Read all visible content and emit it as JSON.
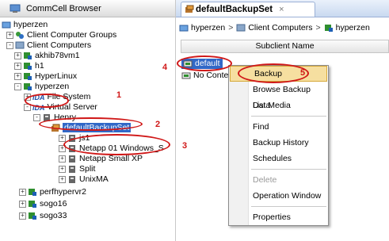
{
  "left_panel": {
    "title": "CommCell Browser",
    "tree": [
      {
        "label": "hyperzen",
        "level": 0,
        "toggle": "",
        "icon": "commcell-icon"
      },
      {
        "label": "Client Computer Groups",
        "level": 1,
        "toggle": "+",
        "icon": "client-group-icon"
      },
      {
        "label": "Client Computers",
        "level": 1,
        "toggle": "-",
        "icon": "client-computers-icon"
      },
      {
        "label": "akhib78vm1",
        "level": 2,
        "toggle": "+",
        "icon": "client-icon"
      },
      {
        "label": "h1",
        "level": 2,
        "toggle": "+",
        "icon": "client-icon"
      },
      {
        "label": "HyperLinux",
        "level": 2,
        "toggle": "+",
        "icon": "client-icon"
      },
      {
        "label": "hyperzen",
        "level": 2,
        "toggle": "-",
        "icon": "client-icon"
      },
      {
        "label": "File System",
        "level": 3,
        "toggle": "+",
        "icon": "idataagent-icon",
        "prefix": "iDA"
      },
      {
        "label": "Virtual Server",
        "level": 3,
        "toggle": "-",
        "icon": "idataagent-icon",
        "prefix": "iDA"
      },
      {
        "label": "Henry",
        "level": 4,
        "toggle": "-",
        "icon": "instance-icon"
      },
      {
        "label": "defaultBackupSet",
        "level": 5,
        "toggle": "",
        "icon": "backupset-icon",
        "selected": true
      },
      {
        "label": "js1",
        "level": 4,
        "toggle": "+",
        "icon": "instance-icon"
      },
      {
        "label": "Netapp 01 Windows_S",
        "level": 4,
        "toggle": "+",
        "icon": "instance-icon"
      },
      {
        "label": "Netapp Small XP",
        "level": 4,
        "toggle": "+",
        "icon": "instance-icon"
      },
      {
        "label": "Split",
        "level": 4,
        "toggle": "+",
        "icon": "instance-icon"
      },
      {
        "label": "UnixMA",
        "level": 4,
        "toggle": "+",
        "icon": "instance-icon"
      },
      {
        "label": "perfhypervr2",
        "level": 2,
        "toggle": "+",
        "icon": "client-icon"
      },
      {
        "label": "sogo16",
        "level": 2,
        "toggle": "+",
        "icon": "client-icon"
      },
      {
        "label": "sogo33",
        "level": 2,
        "toggle": "+",
        "icon": "client-icon"
      }
    ]
  },
  "tab": {
    "label": "defaultBackupSet",
    "close": "×"
  },
  "breadcrumb": [
    "hyperzen",
    "Client Computers",
    "hyperzen"
  ],
  "grid": {
    "column": "Subclient Name",
    "rows": [
      "default",
      "No Conte"
    ]
  },
  "context_menu": [
    {
      "label": "Backup",
      "highlighted": true
    },
    {
      "label": "Browse Backup Data"
    },
    {
      "label": "List Media"
    },
    {
      "separator": true
    },
    {
      "label": "Find"
    },
    {
      "label": "Backup History"
    },
    {
      "label": "Schedules"
    },
    {
      "separator": true
    },
    {
      "label": "Delete",
      "disabled": true
    },
    {
      "label": "Operation Window"
    },
    {
      "separator": true
    },
    {
      "label": "Properties"
    }
  ],
  "annotations": [
    "1",
    "2",
    "3",
    "4",
    "5"
  ],
  "colors": {
    "annotation": "#d01818",
    "selection": "#3168c7",
    "menu_highlight": "#f6dfa0"
  }
}
